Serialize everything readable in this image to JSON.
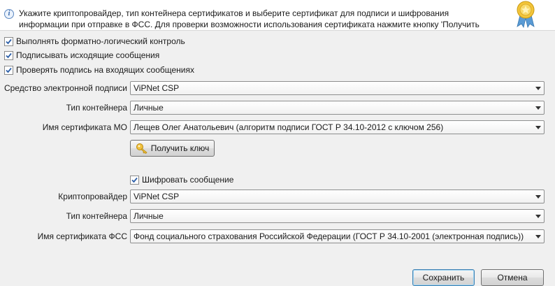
{
  "header": {
    "text_line1": "Укажите криптопровайдер, тип контейнера сертификатов и выберите сертификат для подписи и шифрования",
    "text_line2": "информации при отправке в ФСС. Для проверки возможности использования сертификата нажмите кнопку 'Получить",
    "info_icon": "info-icon",
    "badge_icon": "certificate-badge-icon"
  },
  "options": {
    "format_control": {
      "label": "Выполнять форматно-логический контроль",
      "checked": true
    },
    "sign_outgoing": {
      "label": "Подписывать исходящие сообщения",
      "checked": true
    },
    "verify_incoming": {
      "label": "Проверять подпись на входящих сообщениях",
      "checked": true
    }
  },
  "signature": {
    "tool_label": "Средство электронной подписи",
    "tool_value": "ViPNet CSP",
    "container_label": "Тип контейнера",
    "container_value": "Личные",
    "cert_label": "Имя сертификата МО",
    "cert_value": "Лещев Олег Анатольевич (алгоритм подписи ГОСТ Р 34.10-2012 с ключом 256)",
    "get_key_label": "Получить ключ"
  },
  "encryption": {
    "encrypt_label": "Шифровать сообщение",
    "encrypt_checked": true,
    "provider_label": "Криптопровайдер",
    "provider_value": "ViPNet CSP",
    "container_label": "Тип контейнера",
    "container_value": "Личные",
    "cert_label": "Имя сертификата ФСС",
    "cert_value": "Фонд социального страхования Российской Федерации (ГОСТ Р 34.10-2001 (электронная подпись))"
  },
  "footer": {
    "save_label": "Сохранить",
    "cancel_label": "Отмена"
  },
  "colors": {
    "background": "#f0f0f0",
    "header_background": "#ffffff",
    "primary_button_border": "#3c7fb1"
  }
}
